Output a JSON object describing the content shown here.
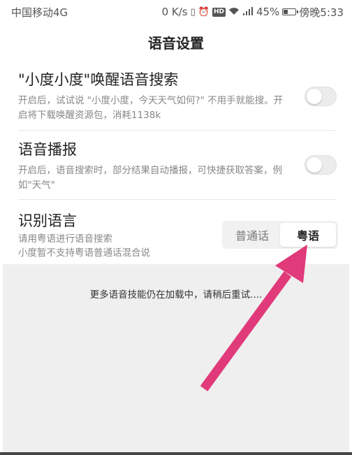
{
  "status_bar": {
    "carrier": "中国移动4G",
    "speed": "0 K/s",
    "battery_percent": "45%",
    "battery_level": 0.45,
    "time": "傍晚5:33",
    "icons": [
      "vibrate-icon",
      "alarm-icon",
      "hd-icon",
      "wifi-icon",
      "signal-icon",
      "battery-icon"
    ]
  },
  "header": {
    "title": "语音设置"
  },
  "settings": [
    {
      "title": "\"小度小度\"唤醒语音搜索",
      "desc_line1": "开启后，试试说 \"小度小度，今天天气如何?\" 不用手就能搜。开",
      "desc_line2": "启将下载唤醒资源包，消耗1138k",
      "enabled": false
    },
    {
      "title": "语音播报",
      "desc_line1": "开启后，语音搜索时，部分结果自动播报，可快捷获取答案，例",
      "desc_line2": "如\"天气\"",
      "enabled": false
    }
  ],
  "language": {
    "title": "识别语言",
    "desc_line1": "请用粤语进行语音搜索",
    "desc_line2": "小度暂不支持粤语普通话混合说",
    "options": [
      "普通话",
      "粤语"
    ],
    "selected": "粤语"
  },
  "footer": {
    "loading_message": "更多语音技能仍在加载中，请稍后重试...."
  },
  "colors": {
    "arrow": "#e03a7a",
    "toggle_off": "#ececec",
    "background_gray": "#efefef"
  }
}
